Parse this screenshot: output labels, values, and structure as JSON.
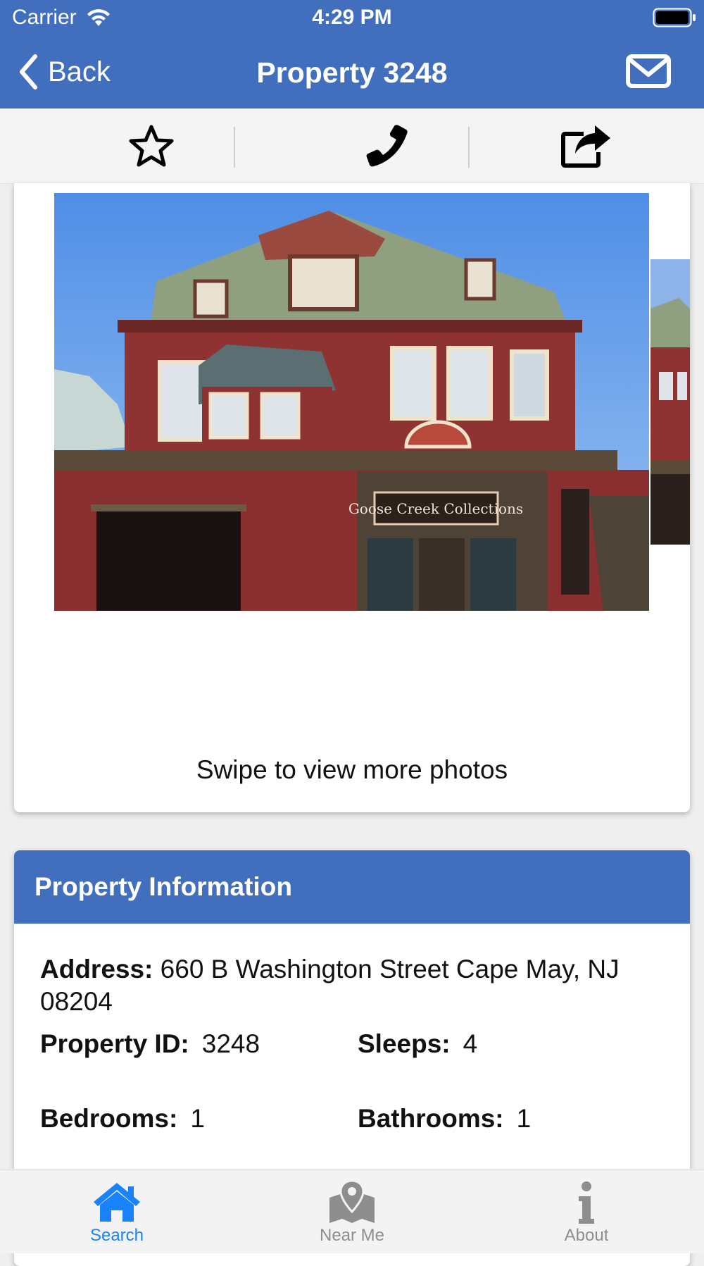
{
  "status_bar": {
    "carrier": "Carrier",
    "time": "4:29 PM",
    "wifi_icon": "wifi-icon",
    "battery_icon": "battery-full-icon"
  },
  "nav": {
    "back_label": "Back",
    "title": "Property 3248",
    "back_icon": "chevron-left-icon",
    "mail_icon": "envelope-icon"
  },
  "actions": [
    {
      "name": "favorite",
      "icon": "star-outline-icon"
    },
    {
      "name": "call",
      "icon": "phone-icon"
    },
    {
      "name": "share",
      "icon": "share-icon"
    }
  ],
  "gallery": {
    "main_photo_sign_text": "Goose Creek Collections",
    "swipe_hint": "Swipe to view more photos"
  },
  "property_info": {
    "title": "Property Information",
    "address_label": "Address:",
    "address_value": "660 B Washington Street Cape May, NJ 08204",
    "property_id_label": "Property ID:",
    "property_id_value": "3248",
    "sleeps_label": "Sleeps:",
    "sleeps_value": "4",
    "bedrooms_label": "Bedrooms:",
    "bedrooms_value": "1",
    "bathrooms_label": "Bathrooms:",
    "bathrooms_value": "1"
  },
  "tabs": [
    {
      "label": "Search",
      "icon": "home-icon",
      "active": true
    },
    {
      "label": "Near Me",
      "icon": "map-pin-icon",
      "active": false
    },
    {
      "label": "About",
      "icon": "info-icon",
      "active": false
    }
  ],
  "colors": {
    "brand_blue": "#426fbd",
    "active_tab": "#1a82fb",
    "inactive_tab": "#8e8e8e"
  }
}
